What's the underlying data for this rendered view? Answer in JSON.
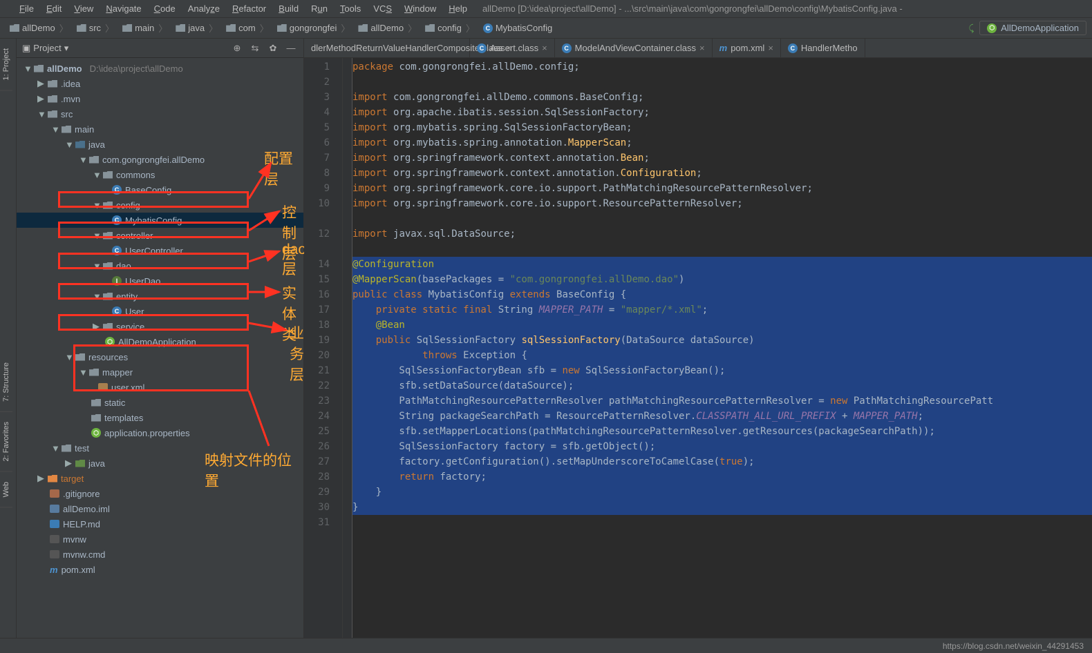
{
  "window_title": "allDemo [D:\\idea\\project\\allDemo] - ...\\src\\main\\java\\com\\gongrongfei\\allDemo\\config\\MybatisConfig.java -",
  "menu": [
    "File",
    "Edit",
    "View",
    "Navigate",
    "Code",
    "Analyze",
    "Refactor",
    "Build",
    "Run",
    "Tools",
    "VCS",
    "Window",
    "Help"
  ],
  "breadcrumbs": [
    "allDemo",
    "src",
    "main",
    "java",
    "com",
    "gongrongfei",
    "allDemo",
    "config",
    "MybatisConfig"
  ],
  "run_config": "AllDemoApplication",
  "proj_label": "Project",
  "left_tabs": [
    "1: Project",
    "7: Structure",
    "2: Favorites",
    "Web"
  ],
  "tree": {
    "root": "allDemo",
    "root_path": "D:\\idea\\project\\allDemo",
    "idea": ".idea",
    "mvn": ".mvn",
    "src": "src",
    "main": "main",
    "java": "java",
    "pkg": "com.gongrongfei.allDemo",
    "commons": "commons",
    "baseconfig": "BaseConfig",
    "config": "config",
    "mybatisconfig": "MybatisConfig",
    "controller": "controller",
    "usercontroller": "UserController",
    "dao": "dao",
    "userdao": "UserDao",
    "entity": "entity",
    "user": "User",
    "service": "service",
    "alldemoapp": "AllDemoApplication",
    "resources": "resources",
    "mapper": "mapper",
    "userxml": "user.xml",
    "static": "static",
    "templates": "templates",
    "appprops": "application.properties",
    "test": "test",
    "java2": "java",
    "target": "target",
    "gitignore": ".gitignore",
    "iml": "allDemo.iml",
    "help": "HELP.md",
    "mvnw": "mvnw",
    "mvnwcmd": "mvnw.cmd",
    "pom": "pom.xml"
  },
  "tabs": [
    {
      "name": "dlerMethodReturnValueHandlerComposite.class"
    },
    {
      "name": "Assert.class"
    },
    {
      "name": "ModelAndViewContainer.class"
    },
    {
      "name": "pom.xml"
    },
    {
      "name": "HandlerMetho"
    }
  ],
  "annotations": {
    "config": "配置层",
    "controller": "控制层",
    "dao": "dao层",
    "entity": "实体类",
    "service": "业务层",
    "mapper": "映射文件的位置"
  },
  "code": {
    "l1": "package com.gongrongfei.allDemo.config;",
    "l3a": "import ",
    "l3b": "com.gongrongfei.allDemo.commons.BaseConfig;",
    "l4": "org.apache.ibatis.session.SqlSessionFactory;",
    "l5": "org.mybatis.spring.SqlSessionFactoryBean;",
    "l6a": "org.mybatis.spring.annotation.",
    "l6b": "MapperScan",
    "l7a": "org.springframework.context.annotation.",
    "l7b": "Bean",
    "l8a": "org.springframework.context.annotation.",
    "l8b": "Configuration",
    "l9": "org.springframework.core.io.support.PathMatchingResourcePatternResolver;",
    "l10": "org.springframework.core.io.support.ResourcePatternResolver;",
    "l12": "javax.sql.DataSource;",
    "l14": "@Configuration",
    "l15a": "@MapperScan",
    "l15b": "(basePackages = ",
    "l15c": "\"com.gongrongfei.allDemo.dao\"",
    "l15d": ")",
    "l16a": "public class ",
    "l16b": "MybatisConfig ",
    "l16c": "extends ",
    "l16d": "BaseConfig {",
    "l17a": "    private static final ",
    "l17b": "String ",
    "l17c": "MAPPER_PATH",
    "l17d": " = ",
    "l17e": "\"mapper/*.xml\"",
    "l17f": ";",
    "l18": "    @Bean",
    "l19a": "    public ",
    "l19b": "SqlSessionFactory ",
    "l19c": "sqlSessionFactory",
    "l19d": "(DataSource dataSource)",
    "l20a": "            throws ",
    "l20b": "Exception {",
    "l21a": "        SqlSessionFactoryBean sfb = ",
    "l21b": "new ",
    "l21c": "SqlSessionFactoryBean();",
    "l22": "        sfb.setDataSource(dataSource);",
    "l23a": "        PathMatchingResourcePatternResolver pathMatchingResourcePatternResolver = ",
    "l23b": "new ",
    "l23c": "PathMatchingResourcePatt",
    "l24a": "        String packageSearchPath = ResourcePatternResolver.",
    "l24b": "CLASSPATH_ALL_URL_PREFIX",
    "l24c": " + ",
    "l24d": "MAPPER_PATH",
    "l24e": ";",
    "l25": "        sfb.setMapperLocations(pathMatchingResourcePatternResolver.getResources(packageSearchPath));",
    "l26": "        SqlSessionFactory factory = sfb.getObject();",
    "l27a": "        factory.getConfiguration().setMapUnderscoreToCamelCase(",
    "l27b": "true",
    "l27c": ");",
    "l28a": "        return ",
    "l28b": "factory;",
    "l29": "    }",
    "l30": "}"
  },
  "status": "https://blog.csdn.net/weixin_44291453"
}
